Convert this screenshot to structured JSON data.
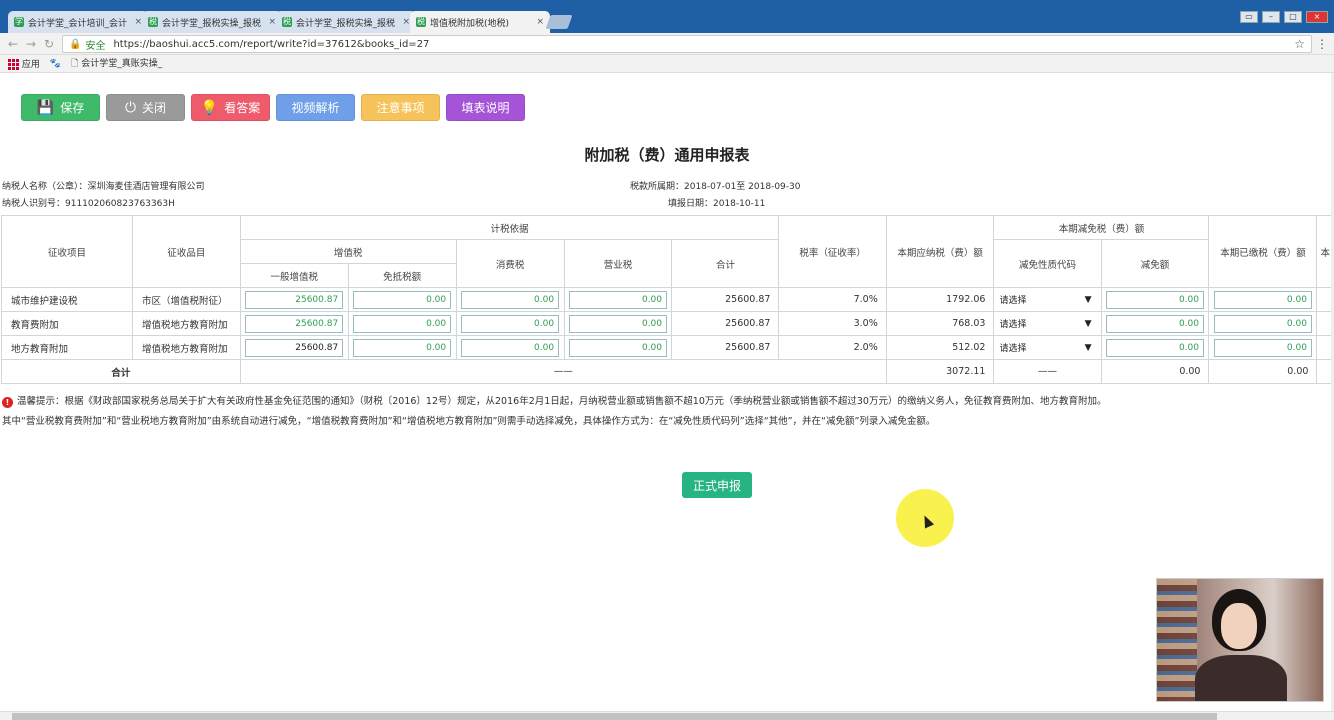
{
  "browser": {
    "tabs": [
      {
        "label": "会计学堂_会计培训_会计",
        "close": "×"
      },
      {
        "label": "会计学堂_报税实操_报税",
        "close": "×"
      },
      {
        "label": "会计学堂_报税实操_报税",
        "close": "×"
      },
      {
        "label": "增值税附加税(地税)",
        "close": "×",
        "active": true
      }
    ],
    "secure_label": "安全",
    "url": "https://baoshui.acc5.com/report/write?id=37612&books_id=27",
    "bookmarks": {
      "apps": "应用",
      "item1": "会计学堂_真账实操_"
    }
  },
  "toolbar": {
    "save": "保存",
    "close": "关闭",
    "answer": "看答案",
    "video": "视频解析",
    "notes": "注意事项",
    "fill_help": "填表说明"
  },
  "form": {
    "title": "附加税（费）通用申报表",
    "taxpayer_name": "纳税人名称（公章）：深圳海麦佳酒店管理有限公司",
    "taxpayer_id": "纳税人识别号：911102060823763363H",
    "period": "税款所属期：2018-07-01至 2018-09-30",
    "fill_date": "填报日期：2018-10-11"
  },
  "table": {
    "headers": {
      "item": "征收项目",
      "subitem": "征收品目",
      "basis": "计税依据",
      "vat": "增值税",
      "vat_general": "一般增值税",
      "vat_exempt": "免抵税额",
      "consumption": "消费税",
      "business": "营业税",
      "total": "合计",
      "rate": "税率（征收率）",
      "payable": "本期应纳税（费）额",
      "reduction": "本期减免税（费）额",
      "reduction_code": "减免性质代码",
      "reduction_amount": "减免额",
      "paid": "本期已缴税（费）额",
      "extra": "本"
    },
    "rows": [
      {
        "item": "城市维护建设税",
        "subitem": "市区（增值税附征）",
        "vat_general": "25600.87",
        "vat_exempt": "0.00",
        "consumption": "0.00",
        "business": "0.00",
        "total": "25600.87",
        "rate": "7.0%",
        "payable": "1792.06",
        "code": "请选择",
        "reduction": "0.00",
        "paid": "0.00"
      },
      {
        "item": "教育费附加",
        "subitem": "增值税地方教育附加",
        "vat_general": "25600.87",
        "vat_exempt": "0.00",
        "consumption": "0.00",
        "business": "0.00",
        "total": "25600.87",
        "rate": "3.0%",
        "payable": "768.03",
        "code": "请选择",
        "reduction": "0.00",
        "paid": "0.00"
      },
      {
        "item": "地方教育附加",
        "subitem": "增值税地方教育附加",
        "vat_general": "25600.87",
        "vat_exempt": "0.00",
        "consumption": "0.00",
        "business": "0.00",
        "total": "25600.87",
        "rate": "2.0%",
        "payable": "512.02",
        "code": "请选择",
        "reduction": "0.00",
        "paid": "0.00"
      }
    ],
    "total_row": {
      "label": "合计",
      "basis": "——",
      "payable": "3072.11",
      "code": "——",
      "reduction": "0.00",
      "paid": "0.00"
    },
    "dropdown_arrow": "▼"
  },
  "notes": {
    "line1": "温馨提示：根据《财政部国家税务总局关于扩大有关政府性基金免征范围的通知》（财税〔2016〕12号）规定，从2016年2月1日起，月纳税营业额或销售额不超10万元（季纳税营业额或销售额不超过30万元）的缴纳义务人，免征教育费附加、地方教育附加。",
    "line2": "其中“营业税教育费附加”和“营业税地方教育附加”由系统自动进行减免，“增值税教育费附加”和“增值税地方教育附加”则需手动选择减免，具体操作方式为：在“减免性质代码列”选择“其他”，并在“减免额”列录入减免金额。"
  },
  "submit": "正式申报",
  "colors": {
    "save": "#3fb96a",
    "close": "#9a9a9a",
    "answer": "#ee5b6b",
    "video": "#6f9fe8",
    "notes": "#f6c35a",
    "fill": "#a554d8",
    "submit": "#26b483",
    "input_text": "#2e9e54"
  }
}
